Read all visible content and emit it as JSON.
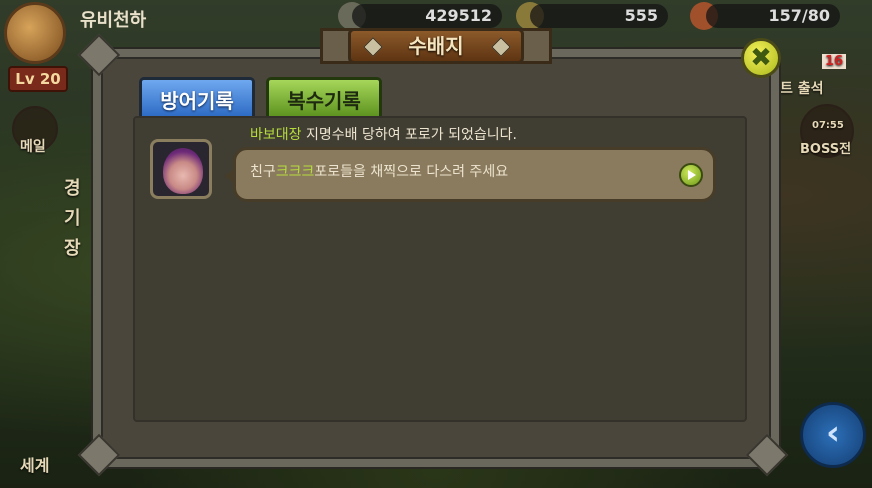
{
  "hud": {
    "player_name": "유비천하",
    "level": "Lv 20",
    "gold": "429512",
    "gems": "555",
    "stamina": "157/80"
  },
  "side": {
    "mail_label": "메일",
    "arena_label": "경\n기\n장",
    "world_label": "세계",
    "attendance_label": "트 출석",
    "attendance_badge": "16",
    "boss_label": "BOSS전",
    "boss_timer": "07:55"
  },
  "dialog": {
    "title": "수배지",
    "tabs": [
      {
        "label": "방어기록",
        "active": true
      },
      {
        "label": "복수기록",
        "active": false
      }
    ],
    "close_label": "✖",
    "entries": [
      {
        "attacker": "바보대장",
        "line1_rest": " 지명수배 당하여 포로가 되었습니다.",
        "line2_prefix": "친구",
        "friend": "크크크",
        "line2_rest": "포로들을 채찍으로 다스려 주세요"
      }
    ]
  },
  "colors": {
    "highlight": "#b6dc3c",
    "tab_active": "#2e6cc5",
    "tab_inactive": "#5e9420"
  }
}
